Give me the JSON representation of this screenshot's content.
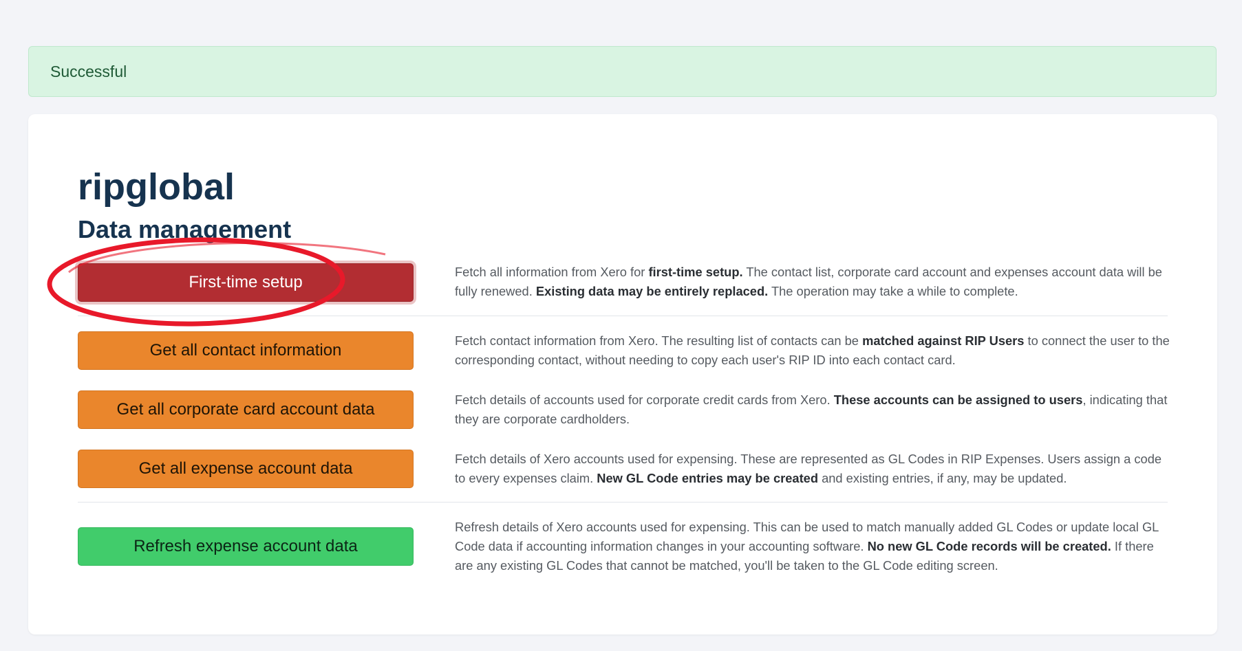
{
  "alert": {
    "message": "Successful"
  },
  "org": {
    "name": "ripglobal"
  },
  "section": {
    "title": "Data management"
  },
  "actions": [
    {
      "label": "First-time setup",
      "variant": "danger",
      "description": [
        {
          "text": "Fetch all information from Xero for "
        },
        {
          "text": "first-time setup.",
          "bold": true
        },
        {
          "text": " The contact list, corporate card account and expenses account data will be fully renewed. "
        },
        {
          "text": "Existing data may be entirely replaced.",
          "bold": true
        },
        {
          "text": " The operation may take a while to complete."
        }
      ]
    },
    {
      "label": "Get all contact information",
      "variant": "warning",
      "description": [
        {
          "text": "Fetch contact information from Xero. The resulting list of contacts can be "
        },
        {
          "text": "matched against RIP Users",
          "bold": true
        },
        {
          "text": " to connect the user to the corresponding contact, without needing to copy each user's RIP ID into each contact card."
        }
      ]
    },
    {
      "label": "Get all corporate card account data",
      "variant": "warning",
      "description": [
        {
          "text": "Fetch details of accounts used for corporate credit cards from Xero. "
        },
        {
          "text": "These accounts can be assigned to users",
          "bold": true
        },
        {
          "text": ", indicating that they are corporate cardholders."
        }
      ]
    },
    {
      "label": "Get all expense account data",
      "variant": "warning",
      "description": [
        {
          "text": "Fetch details of Xero accounts used for expensing. These are represented as GL Codes in RIP Expenses. Users assign a code to every expenses claim. "
        },
        {
          "text": "New GL Code entries may be created",
          "bold": true
        },
        {
          "text": " and existing entries, if any, may be updated."
        }
      ]
    },
    {
      "label": "Refresh expense account data",
      "variant": "success",
      "description": [
        {
          "text": "Refresh details of Xero accounts used for expensing. This can be used to match manually added GL Codes or update local GL Code data if accounting information changes in your accounting software. "
        },
        {
          "text": "No new GL Code records will be created.",
          "bold": true
        },
        {
          "text": " If there are any existing GL Codes that cannot be matched, you'll be taken to the GL Code editing screen."
        }
      ]
    }
  ],
  "colors": {
    "page_background": "#f3f4f8",
    "alert_background": "#d9f4e2",
    "alert_text": "#1f5a36",
    "heading": "#16334f",
    "danger": "#b22d32",
    "warning": "#ea862c",
    "success": "#41cc6b",
    "annotation": "#e8192a"
  }
}
